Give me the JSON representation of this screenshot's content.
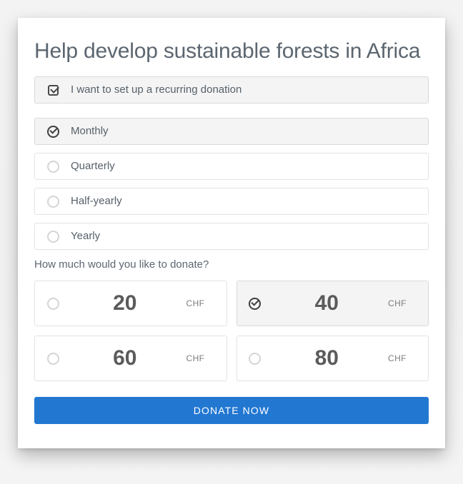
{
  "form": {
    "title": "Help develop sustainable forests in Africa",
    "recurring": {
      "label": "I want to set up a recurring donation",
      "icon": "checkbox-checked-icon",
      "checked": true
    },
    "frequency": {
      "selected": "Monthly",
      "options": [
        {
          "label": "Monthly",
          "selected": true,
          "icon": "radio-checked-icon"
        },
        {
          "label": "Quarterly",
          "selected": false,
          "icon": "radio-empty-icon"
        },
        {
          "label": "Half-yearly",
          "selected": false,
          "icon": "radio-empty-icon"
        },
        {
          "label": "Yearly",
          "selected": false,
          "icon": "radio-empty-icon"
        }
      ]
    },
    "amount": {
      "question": "How much would you like to donate?",
      "currency": "CHF",
      "selected_value": "40",
      "options": [
        {
          "value": "20",
          "currency": "CHF",
          "selected": false,
          "icon": "radio-empty-icon"
        },
        {
          "value": "40",
          "currency": "CHF",
          "selected": true,
          "icon": "radio-checked-icon"
        },
        {
          "value": "60",
          "currency": "CHF",
          "selected": false,
          "icon": "radio-empty-icon"
        },
        {
          "value": "80",
          "currency": "CHF",
          "selected": false,
          "icon": "radio-empty-icon"
        }
      ]
    },
    "submit": {
      "label": "DONATE NOW"
    }
  },
  "colors": {
    "accent": "#2277d1",
    "title_text": "#5c6670",
    "body_text": "#57606a",
    "amount_text": "#5b5b5b",
    "selected_row_bg": "#f4f4f4",
    "row_border": "#e3e3e3",
    "page_bg": "#f3f3f3",
    "card_bg": "#ffffff"
  }
}
